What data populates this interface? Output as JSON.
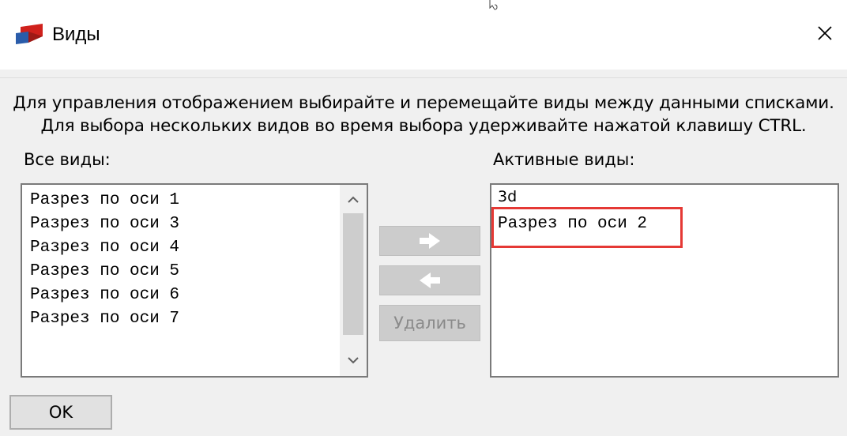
{
  "window": {
    "title": "Виды",
    "close_icon": "close-icon",
    "app_icon": "app-logo-icon"
  },
  "instructions": {
    "line1": "Для управления отображением выбирайте и перемещайте виды между данными списками.",
    "line2": "Для выбора нескольких видов во время выбора удерживайте нажатой клавишу CTRL."
  },
  "all_views": {
    "label": "Все виды:",
    "items": [
      "Разрез по оси 1",
      "Разрез по оси 3",
      "Разрез по оси 4",
      "Разрез по оси 5",
      "Разрез по оси 6",
      "Разрез по оси 7"
    ]
  },
  "active_views": {
    "label": "Активные виды:",
    "items": [
      "3d",
      "Разрез по оси 2"
    ],
    "highlighted_item": "Разрез по оси 2",
    "highlight_color": "#e53935"
  },
  "buttons": {
    "move_right_icon": "arrow-right-icon",
    "move_left_icon": "arrow-left-icon",
    "delete_label": "Удалить",
    "ok_label": "OK"
  }
}
